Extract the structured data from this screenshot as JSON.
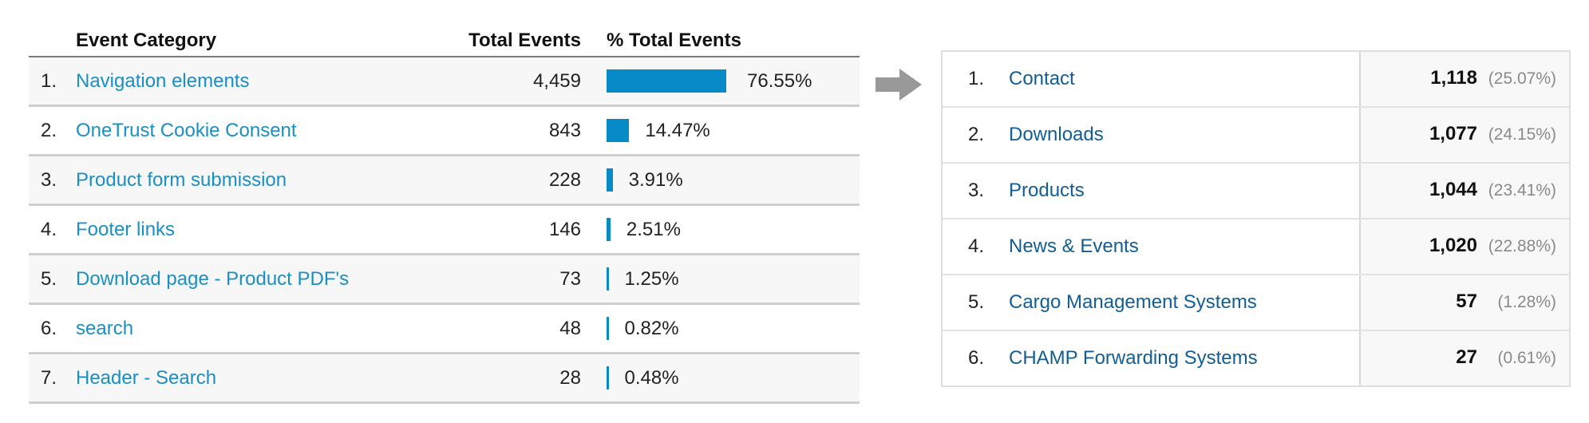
{
  "left_table": {
    "headers": {
      "category": "Event Category",
      "total": "Total Events",
      "percent": "% Total Events"
    },
    "bar_color": "#078bc7",
    "rows": [
      {
        "index": "1.",
        "name": "Navigation elements",
        "total": "4,459",
        "percent": "76.55%",
        "percent_value": 76.55
      },
      {
        "index": "2.",
        "name": "OneTrust Cookie Consent",
        "total": "843",
        "percent": "14.47%",
        "percent_value": 14.47
      },
      {
        "index": "3.",
        "name": "Product form submission",
        "total": "228",
        "percent": "3.91%",
        "percent_value": 3.91
      },
      {
        "index": "4.",
        "name": "Footer links",
        "total": "146",
        "percent": "2.51%",
        "percent_value": 2.51
      },
      {
        "index": "5.",
        "name": "Download page - Product PDF's",
        "total": "73",
        "percent": "1.25%",
        "percent_value": 1.25
      },
      {
        "index": "6.",
        "name": "search",
        "total": "48",
        "percent": "0.82%",
        "percent_value": 0.82
      },
      {
        "index": "7.",
        "name": "Header - Search",
        "total": "28",
        "percent": "0.48%",
        "percent_value": 0.48
      }
    ]
  },
  "arrow": {
    "icon": "arrow-right-icon",
    "color": "#999999"
  },
  "right_table": {
    "rows": [
      {
        "index": "1.",
        "name": "Contact",
        "value": "1,118",
        "percent": "(25.07%)"
      },
      {
        "index": "2.",
        "name": "Downloads",
        "value": "1,077",
        "percent": "(24.15%)"
      },
      {
        "index": "3.",
        "name": "Products",
        "value": "1,044",
        "percent": "(23.41%)"
      },
      {
        "index": "4.",
        "name": "News & Events",
        "value": "1,020",
        "percent": "(22.88%)"
      },
      {
        "index": "5.",
        "name": "Cargo Management Systems",
        "value": "57",
        "percent": "(1.28%)"
      },
      {
        "index": "6.",
        "name": "CHAMP Forwarding Systems",
        "value": "27",
        "percent": "(0.61%)"
      }
    ]
  }
}
